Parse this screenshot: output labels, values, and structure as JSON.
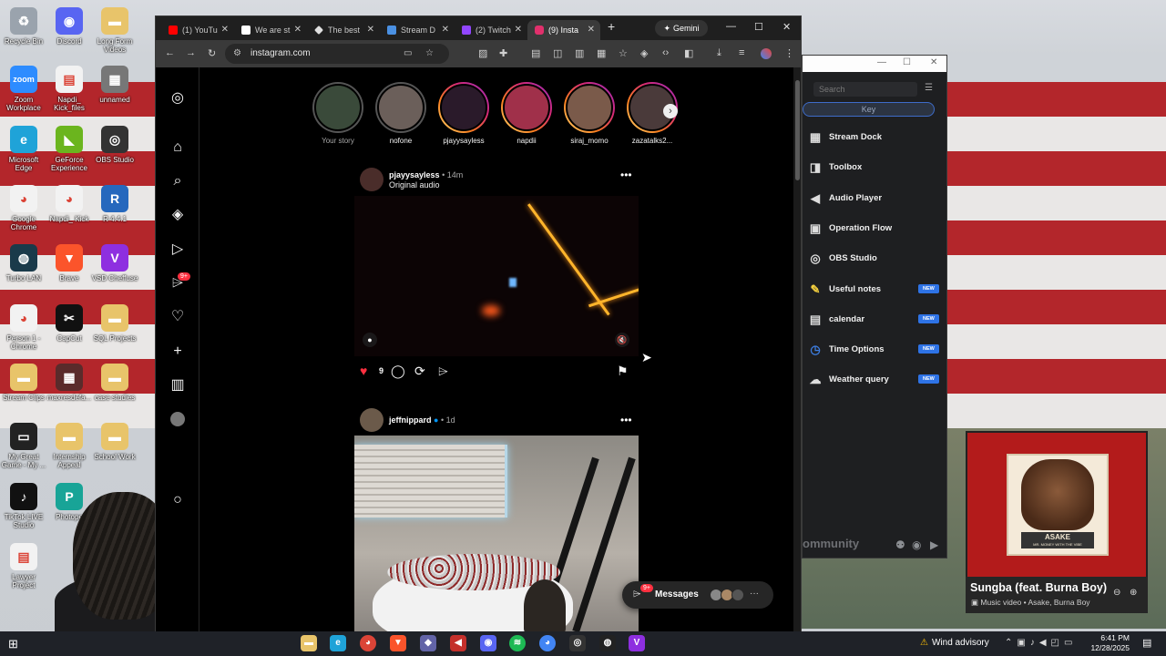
{
  "desktop_icons": [
    {
      "label": "Recycle Bin",
      "icon": "recycle-bin-icon",
      "color": "#9aa3ad",
      "glyph": "♻"
    },
    {
      "label": "Discord",
      "icon": "discord-icon",
      "color": "#5865f2",
      "glyph": "◉"
    },
    {
      "label": "Long Form Videos",
      "icon": "folder-icon",
      "color": "#e8c46a",
      "glyph": "▬"
    },
    {
      "label": "Zoom Workplace",
      "icon": "zoom-icon",
      "color": "#2d8cff",
      "glyph": "zoom"
    },
    {
      "label": "Napdi_ Kick_files",
      "icon": "file-icon",
      "color": "#f2f2f2",
      "glyph": "▤"
    },
    {
      "label": "unnamed",
      "icon": "image-icon",
      "color": "#777",
      "glyph": "▦"
    },
    {
      "label": "Microsoft Edge",
      "icon": "edge-icon",
      "color": "#1fa3d8",
      "glyph": "e"
    },
    {
      "label": "GeForce Experience",
      "icon": "geforce-icon",
      "color": "#6bb51e",
      "glyph": "◣"
    },
    {
      "label": "OBS Studio",
      "icon": "obs-icon",
      "color": "#333",
      "glyph": "◎"
    },
    {
      "label": "Google Chrome",
      "icon": "chrome-icon",
      "color": "#f2f2f2",
      "glyph": "◕"
    },
    {
      "label": "Napdi_ Kick",
      "icon": "chrome-icon",
      "color": "#f2f2f2",
      "glyph": "◕"
    },
    {
      "label": "R 4.4.1",
      "icon": "r-icon",
      "color": "#2668bd",
      "glyph": "R"
    },
    {
      "label": "Turbo LAN",
      "icon": "turbolan-icon",
      "color": "#1a3a4a",
      "glyph": "◍"
    },
    {
      "label": "Brave",
      "icon": "brave-icon",
      "color": "#fb542b",
      "glyph": "▼"
    },
    {
      "label": "VSD Cheffuse",
      "icon": "vsd-icon",
      "color": "#8e2fe0",
      "glyph": "V"
    },
    {
      "label": "Person 1 - Chrome",
      "icon": "chrome-icon",
      "color": "#f2f2f2",
      "glyph": "◕"
    },
    {
      "label": "CapCut",
      "icon": "capcut-icon",
      "color": "#111",
      "glyph": "✂"
    },
    {
      "label": "SQL Projects",
      "icon": "folder-icon",
      "color": "#e8c46a",
      "glyph": "▬"
    },
    {
      "label": "Stream Clips",
      "icon": "folder-icon",
      "color": "#e8c46a",
      "glyph": "▬"
    },
    {
      "label": "maxresdefa...",
      "icon": "image-icon",
      "color": "#5a2b2b",
      "glyph": "▦"
    },
    {
      "label": "case studies",
      "icon": "folder-icon",
      "color": "#e8c46a",
      "glyph": "▬"
    },
    {
      "label": "My Great Game - My ...",
      "icon": "game-icon",
      "color": "#222",
      "glyph": "▭"
    },
    {
      "label": "Internship Appeal",
      "icon": "folder-icon",
      "color": "#e8c46a",
      "glyph": "▬"
    },
    {
      "label": "School Work",
      "icon": "folder-icon",
      "color": "#e8c46a",
      "glyph": "▬"
    },
    {
      "label": "TikTok LIVE Studio",
      "icon": "tiktok-icon",
      "color": "#111",
      "glyph": "♪"
    },
    {
      "label": "Photope",
      "icon": "photopea-icon",
      "color": "#18a497",
      "glyph": "P"
    },
    {
      "label": "Lawyer Project",
      "icon": "file-icon",
      "color": "#f2f2f2",
      "glyph": "▤"
    }
  ],
  "chrome": {
    "tabs": [
      {
        "label": "(1) YouTu",
        "favicon": "youtube-icon",
        "color": "#ff0000"
      },
      {
        "label": "We are st",
        "favicon": "gmail-icon",
        "color": "#ffffff"
      },
      {
        "label": "The best",
        "favicon": "diamond-icon",
        "color": "#e0e0e0"
      },
      {
        "label": "Stream D",
        "favicon": "streamdock-icon",
        "color": "#4a90e2"
      },
      {
        "label": "(2) Twitch",
        "favicon": "twitch-icon",
        "color": "#9146ff"
      },
      {
        "label": "(9) Insta",
        "favicon": "instagram-icon",
        "color": "#e1306c"
      }
    ],
    "gemini_label": "Gemini",
    "url": "instagram.com"
  },
  "instagram": {
    "stories": [
      {
        "name": "Your story",
        "seen": true
      },
      {
        "name": "nofone",
        "seen": true
      },
      {
        "name": "pjayysayless",
        "seen": false
      },
      {
        "name": "napdii",
        "seen": false
      },
      {
        "name": "siraj_momo",
        "seen": false
      },
      {
        "name": "zazatalks2...",
        "seen": false
      }
    ],
    "notif_badge": "9+",
    "post1": {
      "username": "pjayysayless",
      "time": "• 14m",
      "audio": "Original audio",
      "likes": "9"
    },
    "post2": {
      "username": "jeffnippard",
      "time": "• 1d"
    },
    "messages": {
      "label": "Messages",
      "badge": "9+"
    }
  },
  "stream_dock": {
    "search_placeholder": "Search",
    "key_label": "Key",
    "items": [
      {
        "label": "Stream Dock",
        "icon": "grid-icon",
        "glyph": "▦",
        "new": false
      },
      {
        "label": "Toolbox",
        "icon": "toolbox-icon",
        "glyph": "◨",
        "new": false
      },
      {
        "label": "Audio Player",
        "icon": "speaker-icon",
        "glyph": "◀",
        "new": false
      },
      {
        "label": "Operation Flow",
        "icon": "flow-icon",
        "glyph": "▣",
        "new": false
      },
      {
        "label": "OBS Studio",
        "icon": "obs-icon",
        "glyph": "◎",
        "new": false
      },
      {
        "label": "Useful notes",
        "icon": "notes-icon",
        "glyph": "✎",
        "new": true
      },
      {
        "label": "calendar",
        "icon": "calendar-icon",
        "glyph": "▤",
        "new": true
      },
      {
        "label": "Time Options",
        "icon": "clock-icon",
        "glyph": "◷",
        "new": true
      },
      {
        "label": "Weather query",
        "icon": "weather-icon",
        "glyph": "☁",
        "new": true
      }
    ],
    "new_label": "NEW",
    "community_label": "ommunity"
  },
  "spotify": {
    "title": "Sungba (feat. Burna Boy)",
    "subtitle": "Music video • Asake, Burna Boy",
    "art_text": "ASAKE",
    "art_subtext": "MR. MONEY WITH THE VIBE"
  },
  "taskbar": {
    "weather": "Wind advisory",
    "time": "6:41 PM",
    "date": "12/28/2025"
  }
}
